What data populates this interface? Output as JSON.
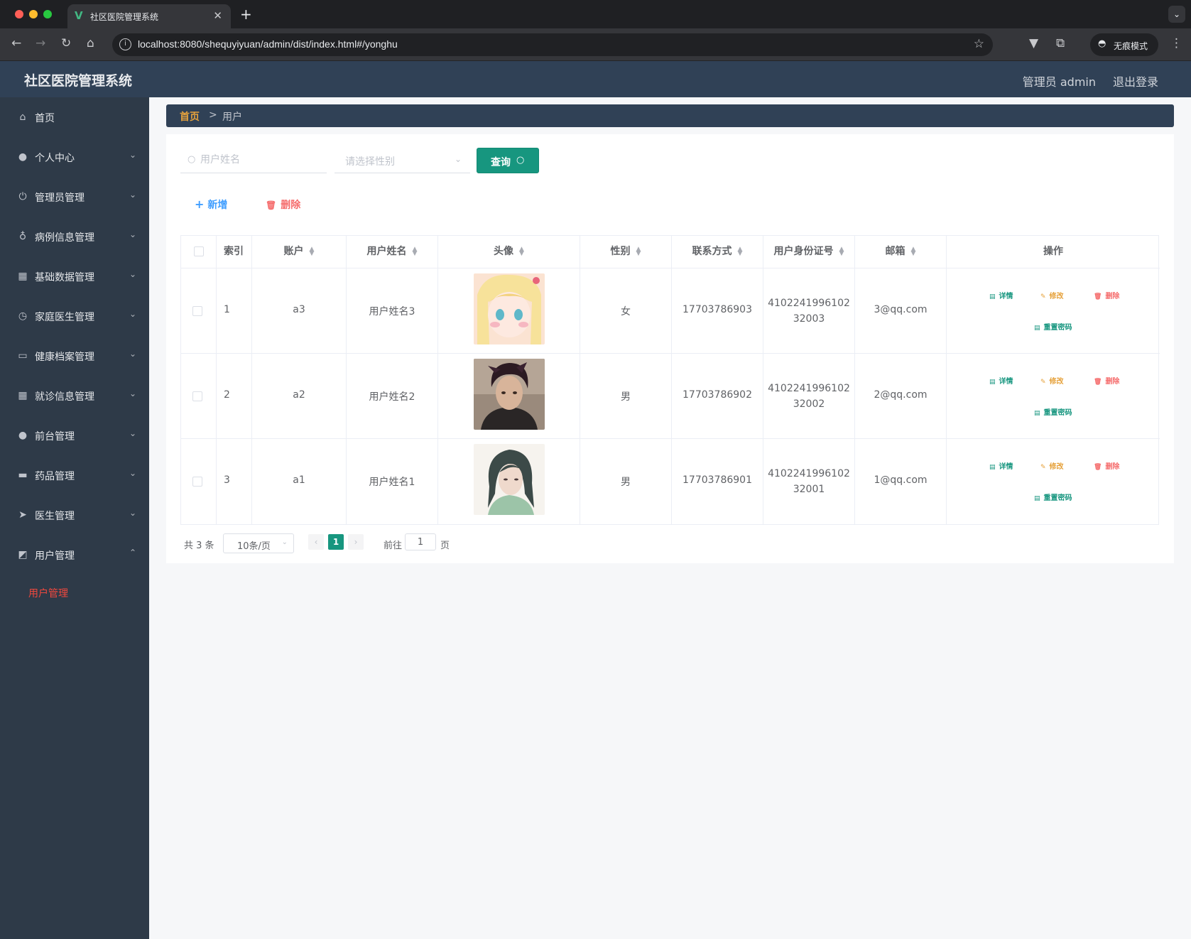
{
  "browser": {
    "tab_title": "社区医院管理系统",
    "url": "localhost:8080/shequyiyuan/admin/dist/index.html#/yonghu",
    "incognito_label": "无痕模式"
  },
  "header": {
    "title": "社区医院管理系统",
    "user": "管理员 admin",
    "logout": "退出登录"
  },
  "sidebar": {
    "items": [
      {
        "label": "首页",
        "icon": "home-icon"
      },
      {
        "label": "个人中心",
        "icon": "user-icon"
      },
      {
        "label": "管理员管理",
        "icon": "power-icon"
      },
      {
        "label": "病例信息管理",
        "icon": "microphone-icon"
      },
      {
        "label": "基础数据管理",
        "icon": "grid-icon"
      },
      {
        "label": "家庭医生管理",
        "icon": "clock-icon"
      },
      {
        "label": "健康档案管理",
        "icon": "id-card-icon"
      },
      {
        "label": "就诊信息管理",
        "icon": "apps-icon"
      },
      {
        "label": "前台管理",
        "icon": "user-icon"
      },
      {
        "label": "药品管理",
        "icon": "monitor-icon"
      },
      {
        "label": "医生管理",
        "icon": "send-icon"
      },
      {
        "label": "用户管理",
        "icon": "chart-icon"
      }
    ],
    "submenu": {
      "label": "用户管理"
    }
  },
  "breadcrumb": {
    "home": "首页",
    "separator": ">",
    "current": "用户"
  },
  "search": {
    "name_placeholder": "用户姓名",
    "gender_placeholder": "请选择性别",
    "query_label": "查询"
  },
  "actions": {
    "add": "新增",
    "delete": "删除"
  },
  "table": {
    "columns": [
      "索引",
      "账户",
      "用户姓名",
      "头像",
      "性别",
      "联系方式",
      "用户身份证号",
      "邮箱",
      "操作"
    ],
    "rows": [
      {
        "index": "1",
        "account": "a3",
        "name": "用户姓名3",
        "gender": "女",
        "phone": "17703786903",
        "id_a": "4102241996102",
        "id_b": "32003",
        "email": "3@qq.com"
      },
      {
        "index": "2",
        "account": "a2",
        "name": "用户姓名2",
        "gender": "男",
        "phone": "17703786902",
        "id_a": "4102241996102",
        "id_b": "32002",
        "email": "2@qq.com"
      },
      {
        "index": "3",
        "account": "a1",
        "name": "用户姓名1",
        "gender": "男",
        "phone": "17703786901",
        "id_a": "4102241996102",
        "id_b": "32001",
        "email": "1@qq.com"
      }
    ],
    "ops": {
      "detail": "详情",
      "edit": "修改",
      "delete": "删除",
      "reset": "重置密码"
    }
  },
  "pagination": {
    "total": "共 3 条",
    "page_size": "10条/页",
    "current": "1",
    "goto": "前往",
    "goto_value": "1",
    "page": "页"
  },
  "colors": {
    "header_bg": "#304156",
    "sidebar_bg": "#2e3a48",
    "accent": "#17967f",
    "danger": "#f56c6c",
    "warning": "#e6a23c",
    "primary": "#409eff"
  }
}
